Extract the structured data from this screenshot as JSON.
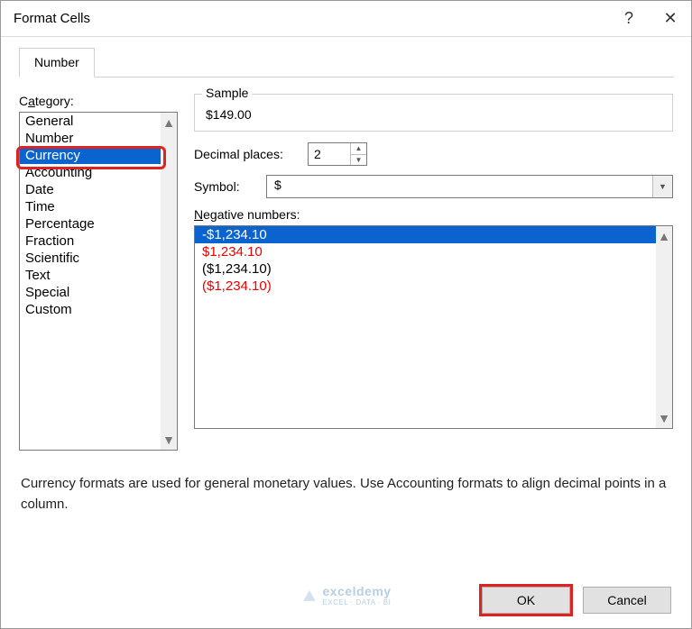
{
  "dialog": {
    "title": "Format Cells",
    "help_icon": "?",
    "close_icon": "✕"
  },
  "tabs": {
    "number": "Number"
  },
  "category": {
    "label_pre": "C",
    "label_u": "a",
    "label_post": "tegory:",
    "items": [
      "General",
      "Number",
      "Currency",
      "Accounting",
      "Date",
      "Time",
      "Percentage",
      "Fraction",
      "Scientific",
      "Text",
      "Special",
      "Custom"
    ],
    "selected_index": 2
  },
  "sample": {
    "legend": "Sample",
    "value": "$149.00"
  },
  "decimal": {
    "label_u": "D",
    "label_post": "ecimal places:",
    "value": "2"
  },
  "symbol": {
    "label_u": "S",
    "label_post": "ymbol:",
    "value": "$"
  },
  "negative": {
    "label_u": "N",
    "label_post": "egative numbers:",
    "options": [
      {
        "text": "-$1,234.10",
        "sel": true,
        "red": false
      },
      {
        "text": "$1,234.10",
        "sel": false,
        "red": true
      },
      {
        "text": "($1,234.10)",
        "sel": false,
        "red": false
      },
      {
        "text": "($1,234.10)",
        "sel": false,
        "red": true
      }
    ]
  },
  "description": "Currency formats are used for general monetary values.  Use Accounting formats to align decimal points in a column.",
  "buttons": {
    "ok": "OK",
    "cancel": "Cancel"
  },
  "watermark": {
    "brand": "exceldemy",
    "sub": "EXCEL · DATA · BI"
  }
}
